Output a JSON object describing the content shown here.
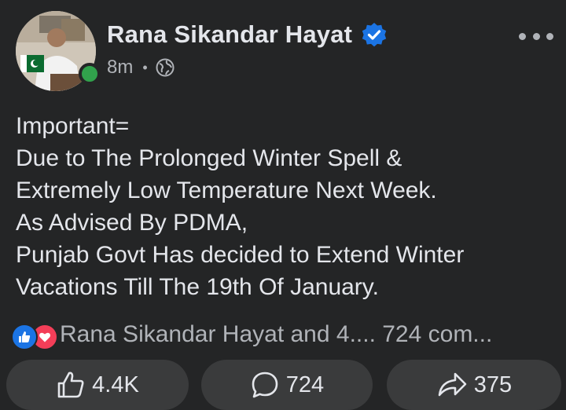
{
  "post": {
    "author": "Rana Sikandar Hayat",
    "time": "8m",
    "separator": "•",
    "visibility_icon": "globe-icon",
    "verified_icon": "verified-badge-icon",
    "text_lines": [
      "Important=",
      "Due to The Prolonged Winter Spell &",
      "Extremely Low Temperature Next Week.",
      "As Advised By PDMA,",
      "Punjab Govt Has decided to Extend Winter",
      "Vacations Till The 19th Of January."
    ]
  },
  "reactions": {
    "icons": [
      "like-icon",
      "love-icon"
    ],
    "summary": "Rana Sikandar Hayat and 4.... 724 com..."
  },
  "actions": {
    "like_count": "4.4K",
    "comment_count": "724",
    "share_count": "375"
  },
  "colors": {
    "background": "#242526",
    "button_bg": "#3a3b3c",
    "primary_text": "#e4e6eb",
    "secondary_text": "#b0b3b8",
    "accent_blue": "#1b74e4",
    "love_red": "#f33e58",
    "online_green": "#31a24c"
  }
}
